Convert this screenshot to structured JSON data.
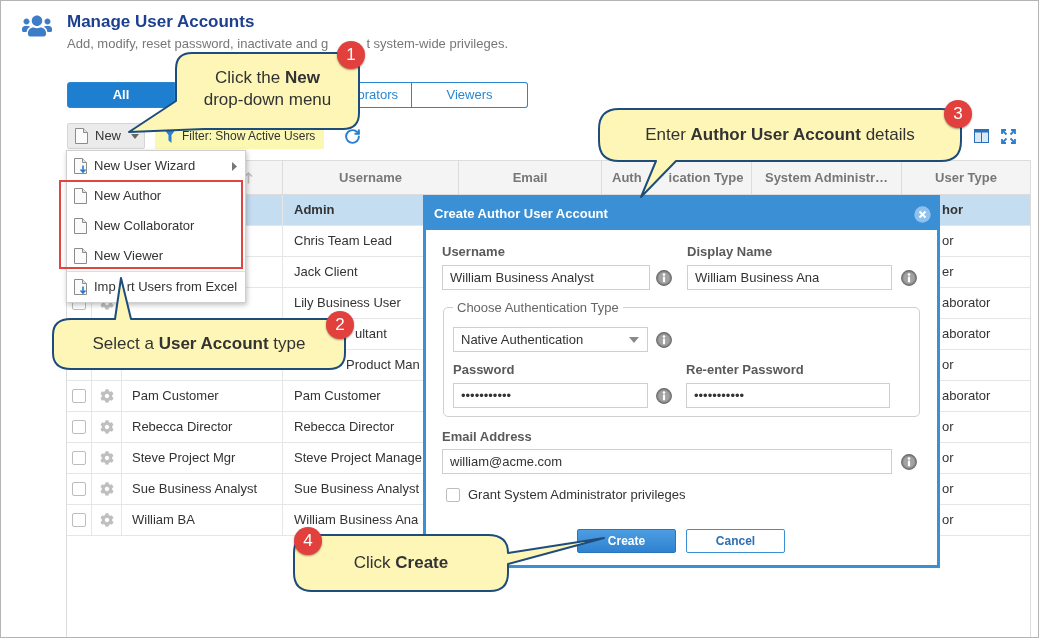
{
  "page": {
    "title": "Manage User Accounts",
    "subtitle_parts": [
      "Add, modify, reset password, inactivate and g",
      "t system-wide privileges."
    ]
  },
  "tabs": [
    {
      "label": "All",
      "selected": true
    },
    {
      "label": "orators",
      "selected": false
    },
    {
      "label": "Viewers",
      "selected": false
    }
  ],
  "toolbar": {
    "new_button": "New",
    "filter": "Filter: Show Active Users"
  },
  "new_menu": {
    "items": [
      {
        "kind": "wizard",
        "label": "New User Wizard",
        "submenu": true
      },
      {
        "kind": "new",
        "label": "New Author",
        "submenu": false
      },
      {
        "kind": "new",
        "label": "New Collaborator",
        "submenu": false
      },
      {
        "kind": "new",
        "label": "New Viewer",
        "submenu": false
      },
      {
        "kind": "import",
        "label_parts": [
          "Imp",
          "rt Users from Excel"
        ],
        "submenu": false
      }
    ]
  },
  "table": {
    "columns": [
      {
        "label": "Username"
      },
      {
        "label": "Email"
      },
      {
        "label_parts": [
          "Auth",
          "ication Type"
        ]
      },
      {
        "label": "System Administr…"
      },
      {
        "label": "User Type"
      }
    ],
    "rows": [
      {
        "selected": true,
        "username": "Admin",
        "user_type": "hor"
      },
      {
        "selected": false,
        "username": "Chris Team Lead",
        "user_type": "or"
      },
      {
        "selected": false,
        "username": "Jack Client",
        "user_type": "er"
      },
      {
        "selected": false,
        "checked": false,
        "username": "Lily Business User",
        "user_type": "aborator"
      },
      {
        "selected": false,
        "username": "ultant",
        "user_type": "aborator"
      },
      {
        "selected": false,
        "username": "Product Man",
        "user_type": "or"
      },
      {
        "selected": false,
        "checked": false,
        "display_name": "Pam Customer",
        "username": "Pam Customer",
        "user_type": "aborator"
      },
      {
        "selected": false,
        "checked": false,
        "display_name": "Rebecca Director",
        "username": "Rebecca Director",
        "user_type": "or"
      },
      {
        "selected": false,
        "checked": false,
        "display_name": "Steve Project Mgr",
        "username": "Steve Project Manage",
        "user_type": "or"
      },
      {
        "selected": false,
        "checked": false,
        "display_name": "Sue Business Analyst",
        "username": "Sue Business Analyst",
        "user_type": "or"
      },
      {
        "selected": false,
        "checked": false,
        "display_name": "William BA",
        "username": "William Business Ana",
        "user_type": "or"
      }
    ]
  },
  "dialog": {
    "title": "Create Author User Account",
    "username": {
      "label": "Username",
      "value": "William Business Analyst"
    },
    "display_name": {
      "label": "Display Name",
      "value": "William Business Ana"
    },
    "auth_group": {
      "legend": "Choose Authentication Type",
      "select": "Native Authentication",
      "password": {
        "label": "Password",
        "value": "•••••••••••"
      },
      "confirm_password": {
        "label": "Re-enter Password",
        "value": "•••••••••••"
      }
    },
    "email": {
      "label": "Email Address",
      "value": "william@acme.com"
    },
    "admin_checkbox": {
      "label": "Grant System Administrator privileges",
      "checked": false
    },
    "buttons": [
      {
        "label": "Create",
        "kind": "primary"
      },
      {
        "label": "Cancel",
        "kind": "secondary"
      }
    ]
  },
  "callouts": [
    {
      "step": "1",
      "text": "Click the **New** drop-down menu"
    },
    {
      "step": "2",
      "text": "Select a **User Account** type"
    },
    {
      "step": "3",
      "text": "Enter **Author User Account** details"
    },
    {
      "step": "4",
      "text": "Click **Create**"
    }
  ]
}
